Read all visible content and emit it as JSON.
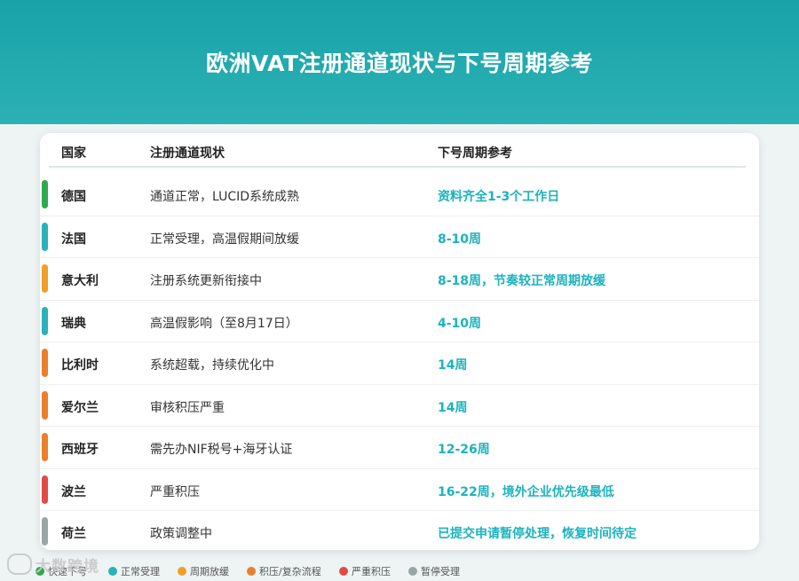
{
  "title": "欧洲VAT注册通道现状与下号周期参考",
  "columns": {
    "country": "国家",
    "status": "注册通道现状",
    "cycle": "下号周期参考"
  },
  "colors": {
    "normal_green": "#2eaa4f",
    "normal_teal": "#2bb2b8",
    "slow": "#f0a028",
    "backlog": "#ec7f2c",
    "severe": "#e34a46",
    "paused": "#9aa6a6",
    "accent_text": "#1cb3be"
  },
  "rows": [
    {
      "country": "德国",
      "status": "通道正常，LUCID系统成熟",
      "cycle": "资料齐全1-3个工作日",
      "color": "#2eaa4f"
    },
    {
      "country": "法国",
      "status": "正常受理，高温假期间放缓",
      "cycle": "8-10周",
      "color": "#2bb2b8"
    },
    {
      "country": "意大利",
      "status": "注册系统更新衔接中",
      "cycle": "8-18周，节奏较正常周期放缓",
      "color": "#f0a028"
    },
    {
      "country": "瑞典",
      "status": "高温假影响（至8月17日）",
      "cycle": "4-10周",
      "color": "#2bb2b8"
    },
    {
      "country": "比利时",
      "status": "系统超载，持续优化中",
      "cycle": "14周",
      "color": "#ec7f2c"
    },
    {
      "country": "爱尔兰",
      "status": "审核积压严重",
      "cycle": "14周",
      "color": "#ec7f2c"
    },
    {
      "country": "西班牙",
      "status": "需先办NIF税号+海牙认证",
      "cycle": "12-26周",
      "color": "#ec7f2c"
    },
    {
      "country": "波兰",
      "status": "严重积压",
      "cycle": "16-22周，境外企业优先级最低",
      "color": "#e34a46"
    },
    {
      "country": "荷兰",
      "status": "政策调整中",
      "cycle": "已提交申请暂停处理，恢复时间待定",
      "color": "#9aa6a6"
    }
  ],
  "legend": [
    {
      "label": "快速下号",
      "color": "#2eaa4f"
    },
    {
      "label": "正常受理",
      "color": "#2bb2b8"
    },
    {
      "label": "周期放缓",
      "color": "#f0a028"
    },
    {
      "label": "积压/复杂流程",
      "color": "#ec7f2c"
    },
    {
      "label": "严重积压",
      "color": "#e34a46"
    },
    {
      "label": "暂停受理",
      "color": "#9aa6a6"
    }
  ],
  "watermark": "大数跨境"
}
